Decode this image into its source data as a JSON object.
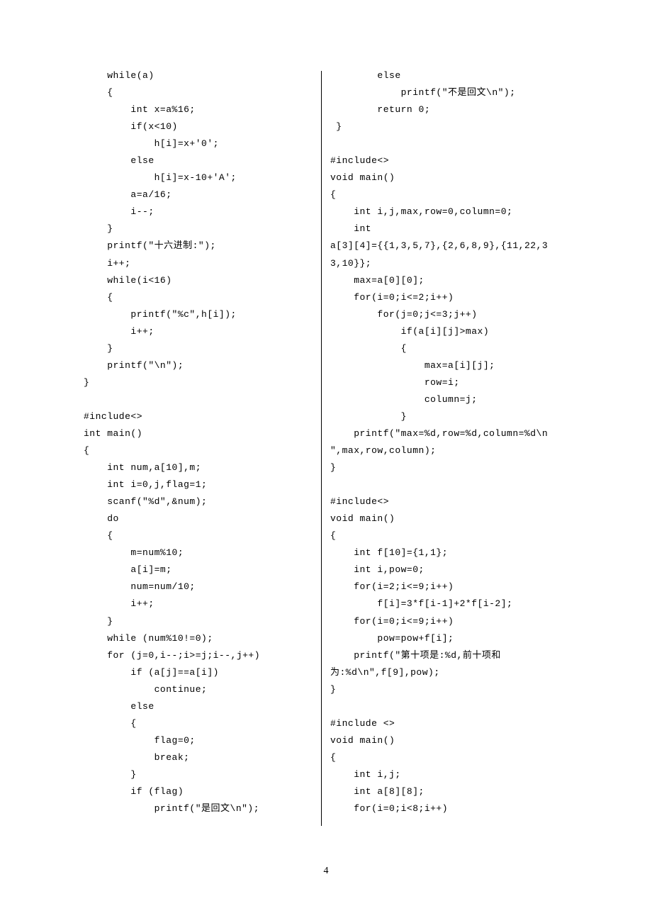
{
  "left_code": "    while(a)\n    {\n        int x=a%16;\n        if(x<10)\n            h[i]=x+'0';\n        else\n            h[i]=x-10+'A';\n        a=a/16;\n        i--;\n    }\n    printf(\"十六进制:\");\n    i++;\n    while(i<16)\n    {\n        printf(\"%c\",h[i]);\n        i++;\n    }\n    printf(\"\\n\");\n}\n\n#include<>\nint main()\n{\n    int num,a[10],m;\n    int i=0,j,flag=1;\n    scanf(\"%d\",&num);\n    do\n    {\n        m=num%10;\n        a[i]=m;\n        num=num/10;\n        i++;\n    }\n    while (num%10!=0);\n    for (j=0,i--;i>=j;i--,j++)\n        if (a[j]==a[i])\n            continue;\n        else\n        {\n            flag=0;\n            break;\n        }\n        if (flag)\n            printf(\"是回文\\n\");",
  "right_code": "        else\n            printf(\"不是回文\\n\");\n        return 0;\n }\n\n#include<>\nvoid main()\n{\n    int i,j,max,row=0,column=0;\n    int\na[3][4]={{1,3,5,7},{2,6,8,9},{11,22,3\n3,10}};\n    max=a[0][0];\n    for(i=0;i<=2;i++)\n        for(j=0;j<=3;j++)\n            if(a[i][j]>max)\n            {\n                max=a[i][j];\n                row=i;\n                column=j;\n            }\n    printf(\"max=%d,row=%d,column=%d\\n\n\",max,row,column);\n}\n\n#include<>\nvoid main()\n{\n    int f[10]={1,1};\n    int i,pow=0;\n    for(i=2;i<=9;i++)\n        f[i]=3*f[i-1]+2*f[i-2];\n    for(i=0;i<=9;i++)\n        pow=pow+f[i];\n    printf(\"第十项是:%d,前十项和\n为:%d\\n\",f[9],pow);\n}\n\n#include <>\nvoid main()\n{\n    int i,j;\n    int a[8][8];\n    for(i=0;i<8;i++)",
  "page_number": "4"
}
